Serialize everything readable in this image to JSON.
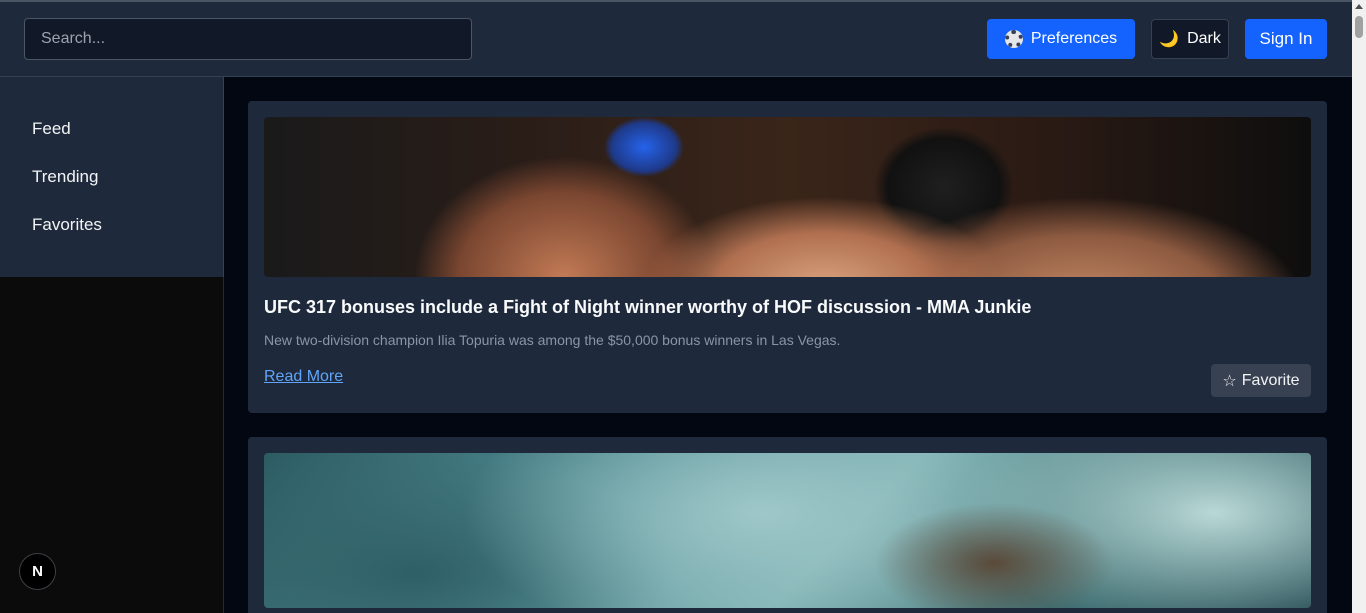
{
  "header": {
    "search_placeholder": "Search...",
    "preferences_label": "Preferences",
    "dark_label": "Dark",
    "signin_label": "Sign In"
  },
  "sidebar": {
    "items": [
      {
        "label": "Feed"
      },
      {
        "label": "Trending"
      },
      {
        "label": "Favorites"
      }
    ]
  },
  "articles": [
    {
      "title": "UFC 317 bonuses include a Fight of Night winner worthy of HOF discussion - MMA Junkie",
      "description": "New two-division champion Ilia Topuria was among the $50,000 bonus winners in Las Vegas.",
      "read_more": "Read More",
      "favorite_label": "Favorite",
      "favorite_icon": "☆"
    },
    {
      "title": "",
      "description": ""
    }
  ],
  "badge": {
    "letter": "N"
  },
  "colors": {
    "accent": "#1463ff",
    "header_bg": "#1e293b",
    "main_bg": "#030712",
    "link": "#60a5fa"
  }
}
